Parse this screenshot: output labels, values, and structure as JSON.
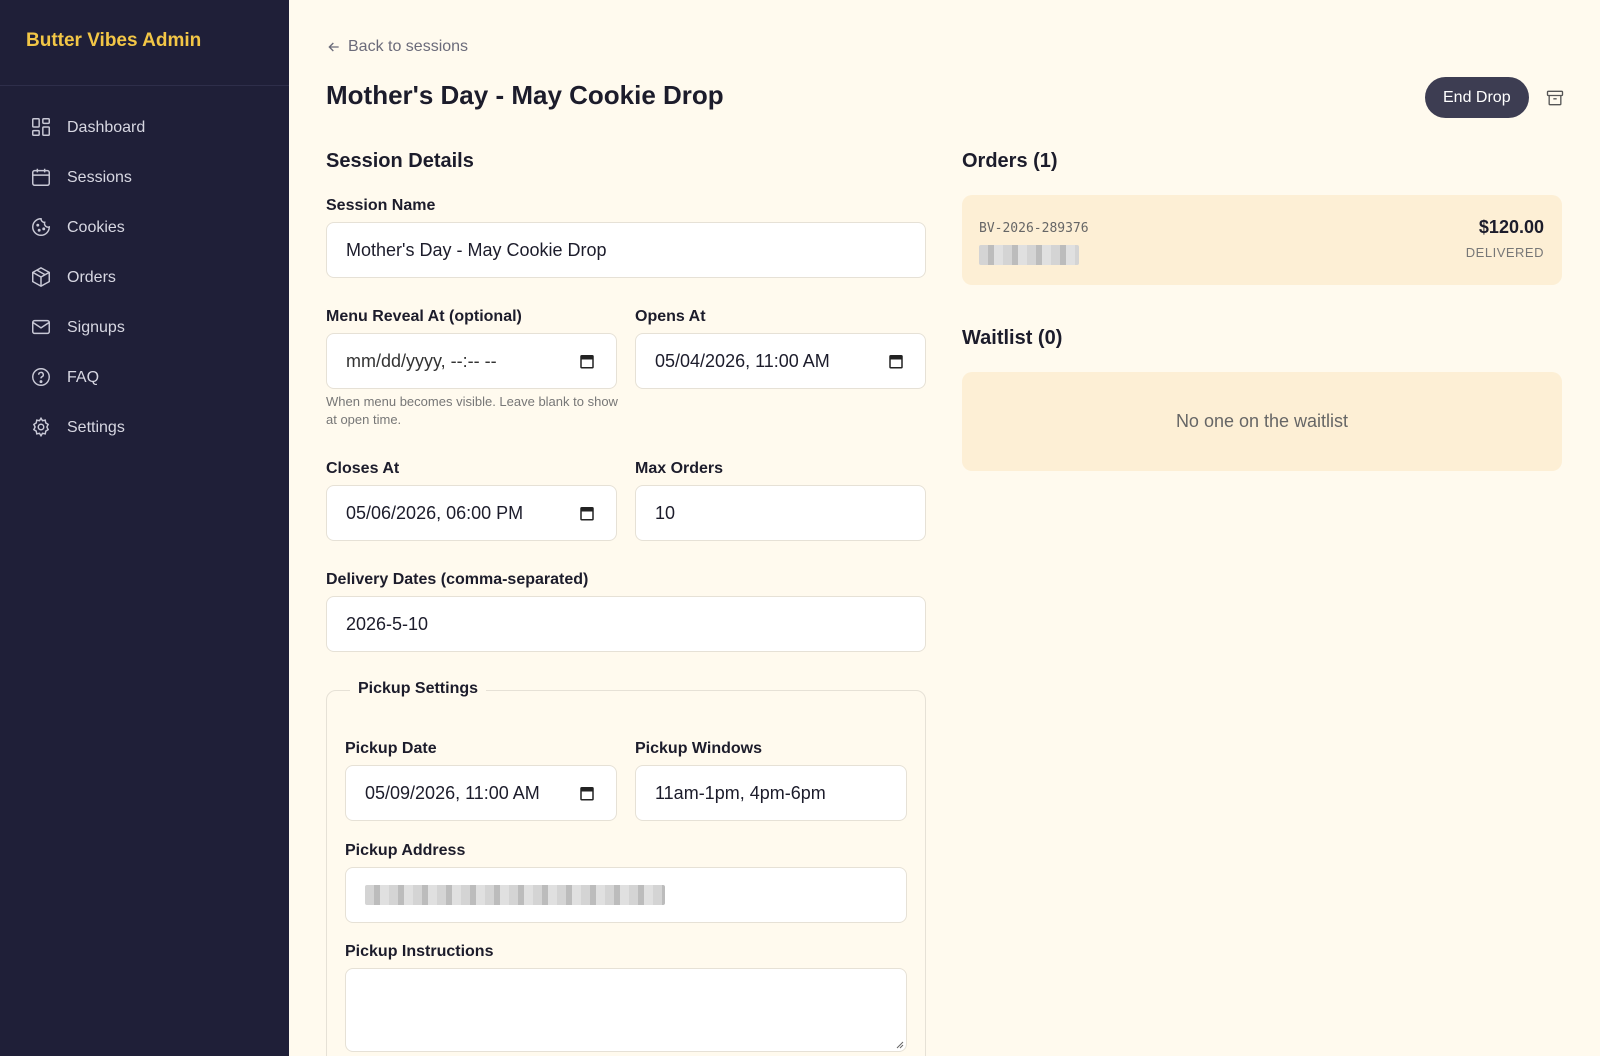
{
  "app": {
    "brand": "Butter Vibes Admin"
  },
  "sidebar": {
    "items": [
      {
        "label": "Dashboard",
        "icon": "dashboard-icon"
      },
      {
        "label": "Sessions",
        "icon": "calendar-icon"
      },
      {
        "label": "Cookies",
        "icon": "cookie-icon"
      },
      {
        "label": "Orders",
        "icon": "box-icon"
      },
      {
        "label": "Signups",
        "icon": "mail-icon"
      },
      {
        "label": "FAQ",
        "icon": "help-circle-icon"
      },
      {
        "label": "Settings",
        "icon": "gear-icon"
      }
    ]
  },
  "header": {
    "back_label": "Back to sessions",
    "title": "Mother's Day - May Cookie Drop",
    "end_button": "End Drop"
  },
  "details": {
    "section_title": "Session Details",
    "session_name_label": "Session Name",
    "session_name_value": "Mother's Day - May Cookie Drop",
    "menu_reveal_label": "Menu Reveal At (optional)",
    "menu_reveal_value": "mm/dd/yyyy, --:-- --",
    "menu_reveal_hint": "When menu becomes visible. Leave blank to show at open time.",
    "opens_at_label": "Opens At",
    "opens_at_value": "05/04/2026, 11:00 AM",
    "closes_at_label": "Closes At",
    "closes_at_value": "05/06/2026, 06:00 PM",
    "max_orders_label": "Max Orders",
    "max_orders_value": "10",
    "delivery_dates_label": "Delivery Dates (comma-separated)",
    "delivery_dates_value": "2026-5-10"
  },
  "pickup": {
    "legend": "Pickup Settings",
    "date_label": "Pickup Date",
    "date_value": "05/09/2026, 11:00 AM",
    "windows_label": "Pickup Windows",
    "windows_value": "11am-1pm, 4pm-6pm",
    "address_label": "Pickup Address",
    "instructions_label": "Pickup Instructions"
  },
  "orders": {
    "title": "Orders (1)",
    "items": [
      {
        "id": "BV-2026-289376",
        "total": "$120.00",
        "status": "DELIVERED"
      }
    ]
  },
  "waitlist": {
    "title": "Waitlist (0)",
    "empty_text": "No one on the waitlist"
  },
  "colors": {
    "sidebar_bg": "#1f1f38",
    "brand": "#f2c646",
    "page_bg": "#fffaee",
    "card_bg": "#fdefd5",
    "button_bg": "#3d3d52"
  }
}
